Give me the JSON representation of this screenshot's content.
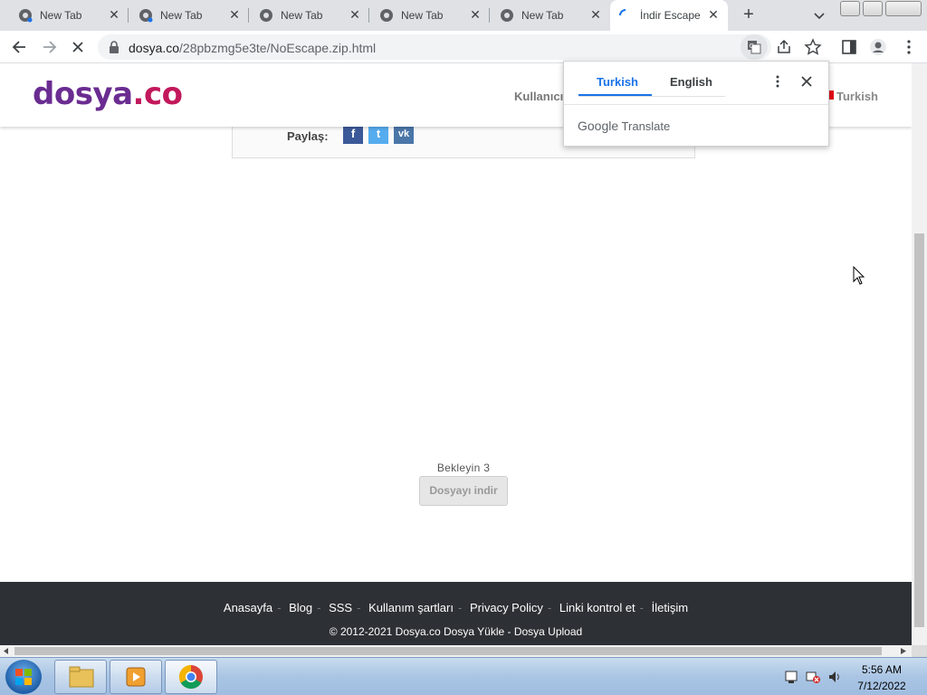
{
  "browser": {
    "tabs": [
      {
        "title": "New Tab"
      },
      {
        "title": "New Tab"
      },
      {
        "title": "New Tab"
      },
      {
        "title": "New Tab"
      },
      {
        "title": "New Tab"
      },
      {
        "title": "İndir Escape"
      }
    ],
    "url_host": "dosya.co",
    "url_path": "/28pbzmg5e3te/NoEscape.zip.html"
  },
  "site": {
    "logo_main": "dosya",
    "logo_suffix": ".co",
    "nav_user": "Kullanıcı",
    "language": "Turkish",
    "share_label": "Paylaş:",
    "wait_text": "Bekleyin 3",
    "download_button": "Dosyayı indir",
    "footer_links": [
      "Anasayfa",
      "Blog",
      "SSS",
      "Kullanım şartları",
      "Privacy Policy",
      "Linki kontrol et",
      "İletişim"
    ],
    "copyright": "© 2012-2021 Dosya.co Dosya Yükle - Dosya Upload"
  },
  "translate_popup": {
    "source_lang": "Turkish",
    "target_lang": "English",
    "brand_google": "Google",
    "brand_translate": "Translate"
  },
  "taskbar": {
    "time": "5:56 AM",
    "date": "7/12/2022"
  },
  "colors": {
    "logo_purple": "#6a2c91",
    "logo_pink": "#c2185b",
    "footer_bg": "#2d3035",
    "accent_blue": "#1a73e8",
    "facebook": "#3b5998",
    "twitter": "#55acee",
    "vk": "#4a76a8"
  }
}
